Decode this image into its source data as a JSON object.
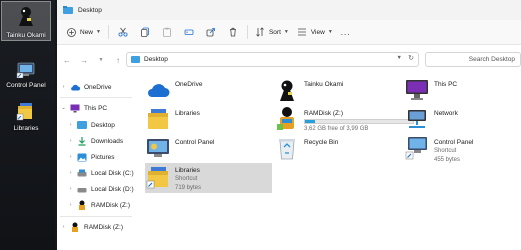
{
  "desktop": {
    "items": [
      {
        "label": "Tainku Okami",
        "icon": "user-folder-icon",
        "selected": true
      },
      {
        "label": "Control Panel",
        "icon": "control-panel-icon",
        "selected": false
      },
      {
        "label": "Libraries",
        "icon": "libraries-icon",
        "selected": false
      }
    ]
  },
  "window": {
    "title": "Desktop",
    "toolbar": {
      "new_label": "New",
      "sort_label": "Sort",
      "view_label": "View",
      "more_label": "..."
    },
    "address": {
      "path": "Desktop",
      "search_placeholder": "Search Desktop"
    }
  },
  "sidebar": {
    "items": [
      {
        "label": "OneDrive",
        "icon": "cloud-icon",
        "level": 0
      },
      {
        "label": "This PC",
        "icon": "pc-icon",
        "level": 0,
        "expanded": true
      },
      {
        "label": "Desktop",
        "icon": "desktop-folder-icon",
        "level": 1
      },
      {
        "label": "Downloads",
        "icon": "downloads-icon",
        "level": 1
      },
      {
        "label": "Pictures",
        "icon": "pictures-icon",
        "level": 1
      },
      {
        "label": "Local Disk (C:)",
        "icon": "drive-icon",
        "level": 1
      },
      {
        "label": "Local Disk (D:)",
        "icon": "drive-icon",
        "level": 1
      },
      {
        "label": "RAMDisk (Z:)",
        "icon": "ramdisk-icon",
        "level": 1
      },
      {
        "label": "RAMDisk (Z:)",
        "icon": "ramdisk-icon",
        "level": 0
      }
    ]
  },
  "content": {
    "items": [
      {
        "name": "OneDrive",
        "icon": "cloud-icon"
      },
      {
        "name": "Tainku Okami",
        "icon": "user-icon"
      },
      {
        "name": "This PC",
        "icon": "pc-icon"
      },
      {
        "name": "Libraries",
        "icon": "libraries-icon"
      },
      {
        "name": "RAMDisk (Z:)",
        "icon": "ramdisk-icon",
        "sub": "3,62 GB free of 3,99 GB",
        "used_fraction": 0.09
      },
      {
        "name": "Network",
        "icon": "network-icon"
      },
      {
        "name": "Control Panel",
        "icon": "control-panel-icon"
      },
      {
        "name": "Recycle Bin",
        "icon": "recycle-bin-icon"
      },
      {
        "name": "Control Panel",
        "icon": "control-panel-icon",
        "sub": "Shortcut",
        "sub2": "455 bytes"
      },
      {
        "name": "Libraries",
        "icon": "libraries-icon",
        "sub": "Shortcut",
        "sub2": "719 bytes",
        "selected": true
      }
    ]
  },
  "colors": {
    "accent": "#26a0da",
    "folder": "#f2c744",
    "selection": "#d9d9d9"
  }
}
